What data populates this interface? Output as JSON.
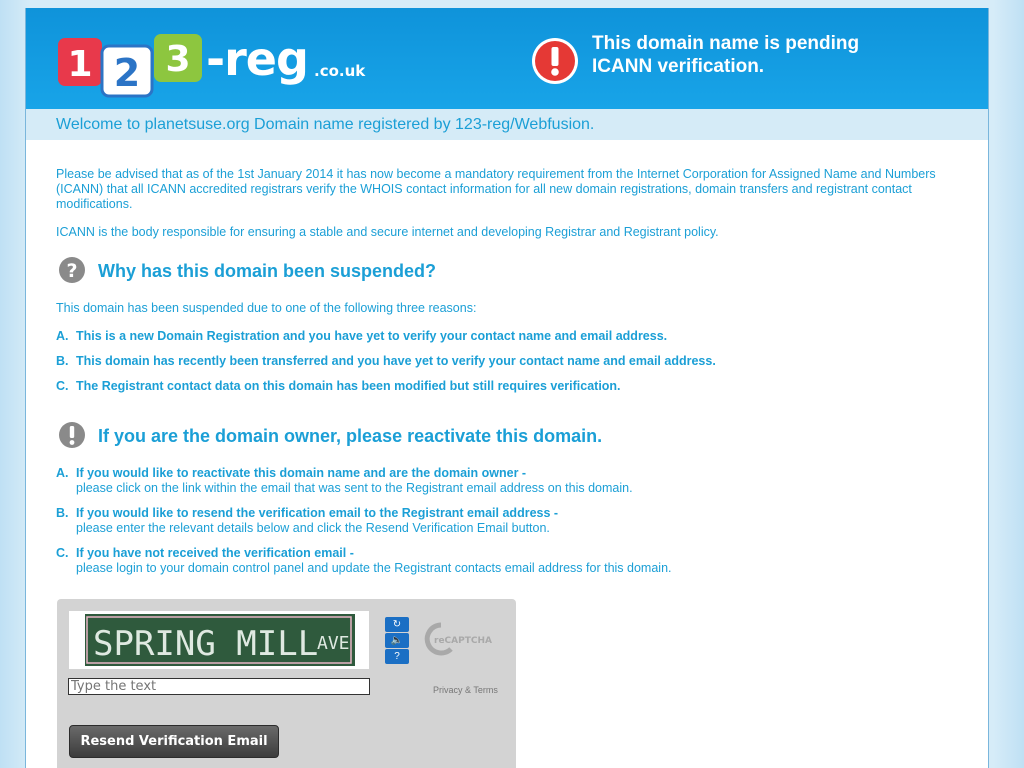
{
  "header": {
    "logo_word": "-reg",
    "logo_tld": ".co.uk",
    "logo_digits": [
      "1",
      "2",
      "3"
    ],
    "alert_line1": "This domain name is pending",
    "alert_line2": "ICANN verification."
  },
  "welcome": "Welcome to planetsuse.org Domain name registered by 123-reg/Webfusion.",
  "intro": {
    "p1": "Please be advised that as of the 1st January 2014 it has now become a mandatory requirement from the Internet Corporation for Assigned Name and Numbers (ICANN) that all ICANN accredited registrars verify the WHOIS contact information for all new domain registrations, domain transfers and registrant contact modifications.",
    "p2": "ICANN is the body responsible for ensuring a stable and secure internet and developing Registrar and Registrant policy."
  },
  "suspended": {
    "heading": "Why has this domain been suspended?",
    "lead": "This domain has been suspended due to one of the following three reasons:",
    "items": [
      {
        "letter": "A.",
        "text": "This is a new Domain Registration and you have yet to verify your contact name and email address."
      },
      {
        "letter": "B.",
        "text": "This domain has recently been transferred and you have yet to verify your contact name and email address."
      },
      {
        "letter": "C.",
        "text": "The Registrant contact data on this domain has been modified but still requires verification."
      }
    ]
  },
  "owner": {
    "heading": "If you are the domain owner, please reactivate this domain.",
    "items": [
      {
        "letter": "A.",
        "bold": "If you would like to reactivate this domain name and are the domain owner -",
        "sub": "please click on the link within the email that was sent to the Registrant email address on this domain."
      },
      {
        "letter": "B.",
        "bold": "If you would like to resend the verification email to the Registrant email address -",
        "sub": "please enter the relevant details below and click the Resend Verification Email button."
      },
      {
        "letter": "C.",
        "bold": "If you have not received the verification email -",
        "sub": "please login to your domain control panel and update the Registrant contacts email address for this domain."
      }
    ]
  },
  "captcha": {
    "image_text": "SPRING MILL",
    "image_suffix": "AVE",
    "placeholder": "Type the text",
    "brand": "reCAPTCHA",
    "privacy": "Privacy & Terms",
    "buttons": [
      "refresh-icon",
      "audio-icon",
      "help-icon"
    ]
  },
  "resend_button": "Resend Verification Email",
  "colors": {
    "header_blue": "#1096dc",
    "text_blue": "#1b9fd6",
    "welcome_bg": "#d5ebf7",
    "alert_red": "#e53935"
  }
}
